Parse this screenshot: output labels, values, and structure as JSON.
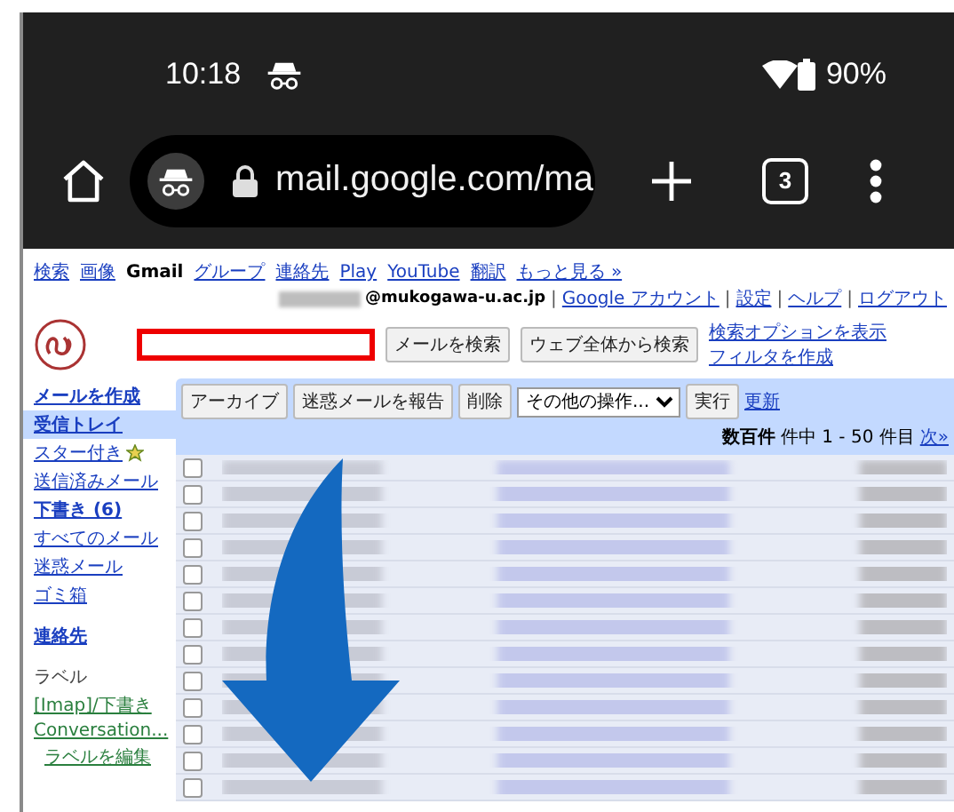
{
  "status_bar": {
    "time": "10:18",
    "battery": "90%"
  },
  "browser": {
    "url": "mail.google.com/ma",
    "tab_count": "3"
  },
  "gmail": {
    "top_nav": [
      {
        "label": "検索",
        "kind": "link"
      },
      {
        "label": "画像",
        "kind": "link"
      },
      {
        "label": "Gmail",
        "kind": "current"
      },
      {
        "label": "グループ",
        "kind": "link"
      },
      {
        "label": "連絡先",
        "kind": "link"
      },
      {
        "label": "Play",
        "kind": "link"
      },
      {
        "label": "YouTube",
        "kind": "link"
      },
      {
        "label": "翻訳",
        "kind": "link"
      },
      {
        "label": "もっと見る »",
        "kind": "link"
      }
    ],
    "account": {
      "email": "@mukogawa-u.ac.jp",
      "items": [
        {
          "text": "|",
          "kind": "separator"
        },
        {
          "text": "Google アカウント",
          "kind": "link"
        },
        {
          "text": "|",
          "kind": "separator"
        },
        {
          "text": "設定",
          "kind": "link"
        },
        {
          "text": "|",
          "kind": "separator"
        },
        {
          "text": "ヘルプ",
          "kind": "link"
        },
        {
          "text": "|",
          "kind": "separator"
        },
        {
          "text": "ログアウト",
          "kind": "link"
        }
      ]
    },
    "search": {
      "highlighted": true,
      "buttons": [
        "メールを検索",
        "ウェブ全体から検索"
      ],
      "links": [
        "検索オプションを表示",
        "フィルタを作成"
      ]
    },
    "sidebar": {
      "compose": "メールを作成",
      "folders": [
        {
          "label": "受信トレイ",
          "selected": true,
          "bold": true,
          "star": false
        },
        {
          "label": "スター付き",
          "selected": false,
          "bold": false,
          "star": true
        },
        {
          "label": "送信済みメール",
          "selected": false,
          "bold": false,
          "star": false
        },
        {
          "label": "下書き (6)",
          "selected": false,
          "bold": true,
          "star": false
        },
        {
          "label": "すべてのメール",
          "selected": false,
          "bold": false,
          "star": false
        },
        {
          "label": "迷惑メール",
          "selected": false,
          "bold": false,
          "star": false
        },
        {
          "label": "ゴミ箱",
          "selected": false,
          "bold": false,
          "star": false
        }
      ],
      "contacts": "連絡先",
      "labels_heading": "ラベル",
      "labels": [
        "[Imap]/下書き",
        "Conversation..."
      ],
      "edit_labels": "ラベルを編集"
    },
    "toolbar": {
      "buttons": [
        "アーカイブ",
        "迷惑メールを報告",
        "削除"
      ],
      "more_actions": "その他の操作...",
      "run": "実行",
      "refresh": "更新",
      "count_bold": "数百件",
      "count": "件中 1 - 50 件目",
      "next": "次»"
    },
    "messages": [
      {
        "checked": false
      },
      {
        "checked": false
      },
      {
        "checked": false
      },
      {
        "checked": false
      },
      {
        "checked": false
      },
      {
        "checked": false
      },
      {
        "checked": false
      },
      {
        "checked": false
      },
      {
        "checked": false
      },
      {
        "checked": false
      },
      {
        "checked": false
      },
      {
        "checked": false
      },
      {
        "checked": false
      }
    ]
  }
}
